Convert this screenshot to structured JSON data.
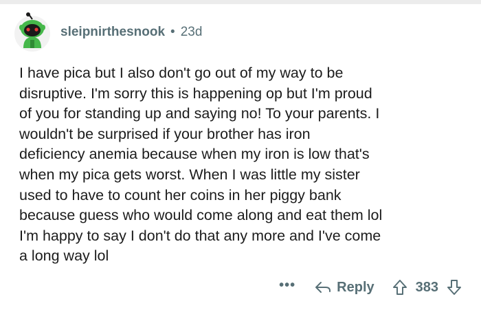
{
  "comment": {
    "author": "sleipnirthesnook",
    "separator": "•",
    "age": "23d",
    "text": "I have pica but I also don't go out of my way to be\ndisruptive.  I'm sorry this is happening op but I'm proud\nof you for standing up and saying no! To your parents. I\nwouldn't be surprised if your brother has iron\ndeficiency anemia because when my iron is low that's\nwhen my pica gets worst. When I was little my sister\nused to have to count her coins in her piggy bank\nbecause guess who would come along and eat them lol\nI'm happy to say I don't do that any more and I've come\na long way lol"
  },
  "actions": {
    "more_label": "•••",
    "reply_label": "Reply",
    "score": "383"
  },
  "icons": {
    "more": "more-options-icon",
    "reply": "reply-arrow-icon",
    "upvote": "upvote-arrow-icon",
    "downvote": "downvote-arrow-icon"
  },
  "colors": {
    "meta_gray": "#576f76",
    "text": "#1c1c1c",
    "avatar_green": "#46b84b"
  }
}
